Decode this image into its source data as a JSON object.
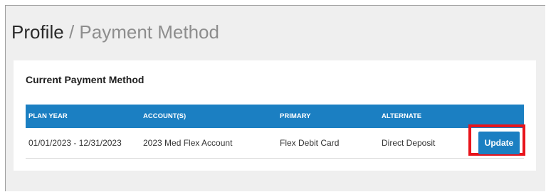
{
  "breadcrumb": {
    "current": "Profile",
    "separator": "/",
    "sub": "Payment Method"
  },
  "card": {
    "title": "Current Payment Method"
  },
  "table": {
    "headers": [
      "PLAN YEAR",
      "ACCOUNT(S)",
      "PRIMARY",
      "ALTERNATE"
    ],
    "rows": [
      {
        "plan_year": "01/01/2023 - 12/31/2023",
        "accounts": "2023 Med Flex Account",
        "primary": "Flex Debit Card",
        "alternate": "Direct Deposit",
        "action_label": "Update"
      }
    ]
  },
  "colors": {
    "accent": "#1b7fc2",
    "highlight": "#e8141b",
    "background": "#efefef"
  }
}
